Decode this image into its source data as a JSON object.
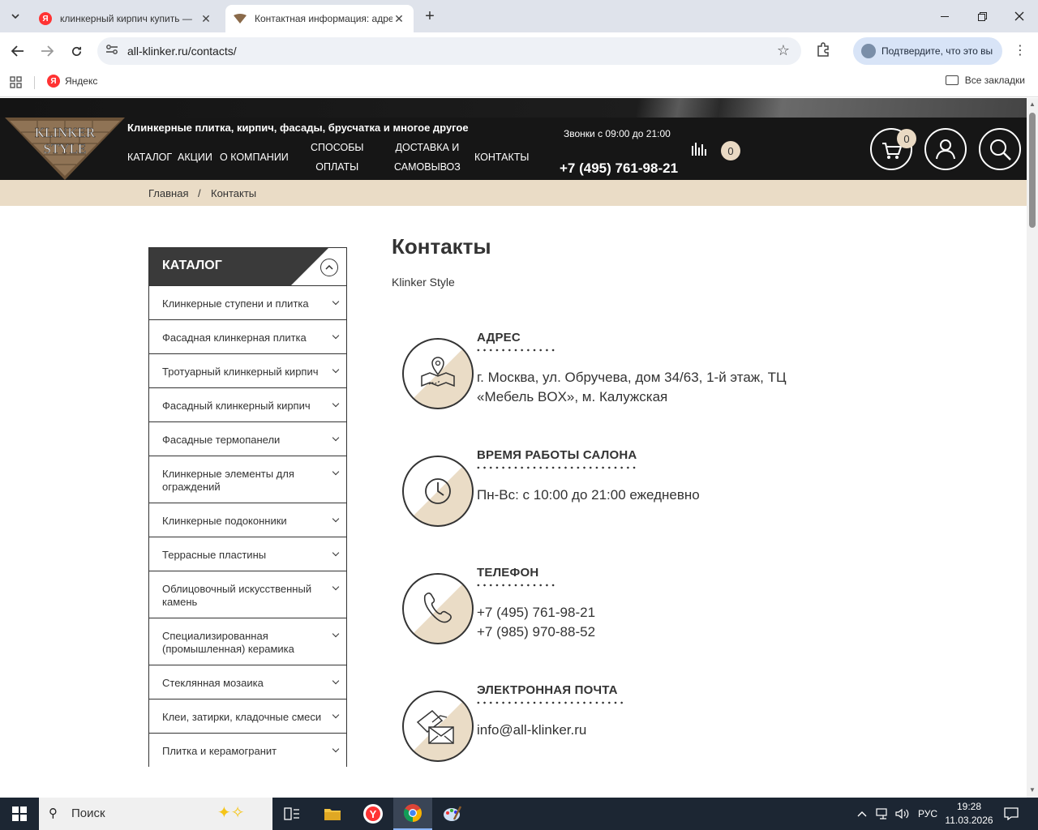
{
  "browser": {
    "tabs": [
      {
        "title": "клинкерный кирпич купить —",
        "active": false
      },
      {
        "title": "Контактная информация: адре",
        "active": true
      }
    ],
    "url": "all-klinker.ru/contacts/",
    "verify_label": "Подтвердите, что это вы",
    "bookmarks": {
      "yandex": "Яндекс",
      "all": "Все закладки"
    }
  },
  "site": {
    "tagline": "Клинкерные плитка, кирпич, фасады, брусчатка и многое другое",
    "nav": [
      {
        "label": "КАТАЛОГ"
      },
      {
        "label": "АКЦИИ"
      },
      {
        "label": "О КОМПАНИИ"
      },
      {
        "label1": "СПОСОБЫ",
        "label2": "ОПЛАТЫ"
      },
      {
        "label1": "ДОСТАВКА И",
        "label2": "САМОВЫВОЗ"
      },
      {
        "label": "КОНТАКТЫ"
      }
    ],
    "calls": "Звонки с 09:00 до 21:00",
    "phone": "+7 (495) 761-98-21",
    "compare_count": "0",
    "cart_count": "0",
    "logo_text": [
      "KLINKER",
      "STYLE"
    ],
    "colors": {
      "accent": "#eadcc6",
      "header": "#161616"
    }
  },
  "breadcrumbs": {
    "home": "Главная",
    "sep": "/",
    "current": "Контакты"
  },
  "sidebar": {
    "title": "КАТАЛОГ",
    "items": [
      {
        "label": "Клинкерные ступени и плитка"
      },
      {
        "label": "Фасадная клинкерная плитка"
      },
      {
        "label": "Тротуарный клинкерный кирпич"
      },
      {
        "label": "Фасадный клинкерный кирпич"
      },
      {
        "label": "Фасадные термопанели"
      },
      {
        "label": "Клинкерные элементы для ограждений"
      },
      {
        "label": "Клинкерные подоконники"
      },
      {
        "label": "Террасные пластины"
      },
      {
        "label": "Облицовочный искусственный камень"
      },
      {
        "label": "Специализированная (промышленная) керамика"
      },
      {
        "label": "Стеклянная мозаика"
      },
      {
        "label": "Клеи, затирки, кладочные смеси"
      },
      {
        "label": "Плитка и керамогранит"
      }
    ]
  },
  "content": {
    "title": "Контакты",
    "company": "Klinker Style",
    "blocks": [
      {
        "label": "АДРЕС",
        "line1": "г. Москва, ул. Обручева, дом 34/63, 1-й этаж, ТЦ",
        "line2": "«Мебель BOX», м. Калужская",
        "icon": "map-pin-icon"
      },
      {
        "label": "ВРЕМЯ РАБОТЫ САЛОНА",
        "line1": "Пн-Вс: с 10:00 до 21:00 ежедневно",
        "line2": "",
        "icon": "clock-icon"
      },
      {
        "label": "ТЕЛЕФОН",
        "line1": "+7 (495) 761-98-21",
        "line2": "+7 (985) 970-88-52",
        "icon": "phone-icon"
      },
      {
        "label": "ЭЛЕКТРОННАЯ ПОЧТА",
        "line1": "info@all-klinker.ru",
        "line2": "",
        "icon": "mail-icon"
      }
    ]
  },
  "taskbar": {
    "search_placeholder": "Поиск",
    "lang": "РУС",
    "time": "19:28",
    "date": "11.03.2026"
  }
}
